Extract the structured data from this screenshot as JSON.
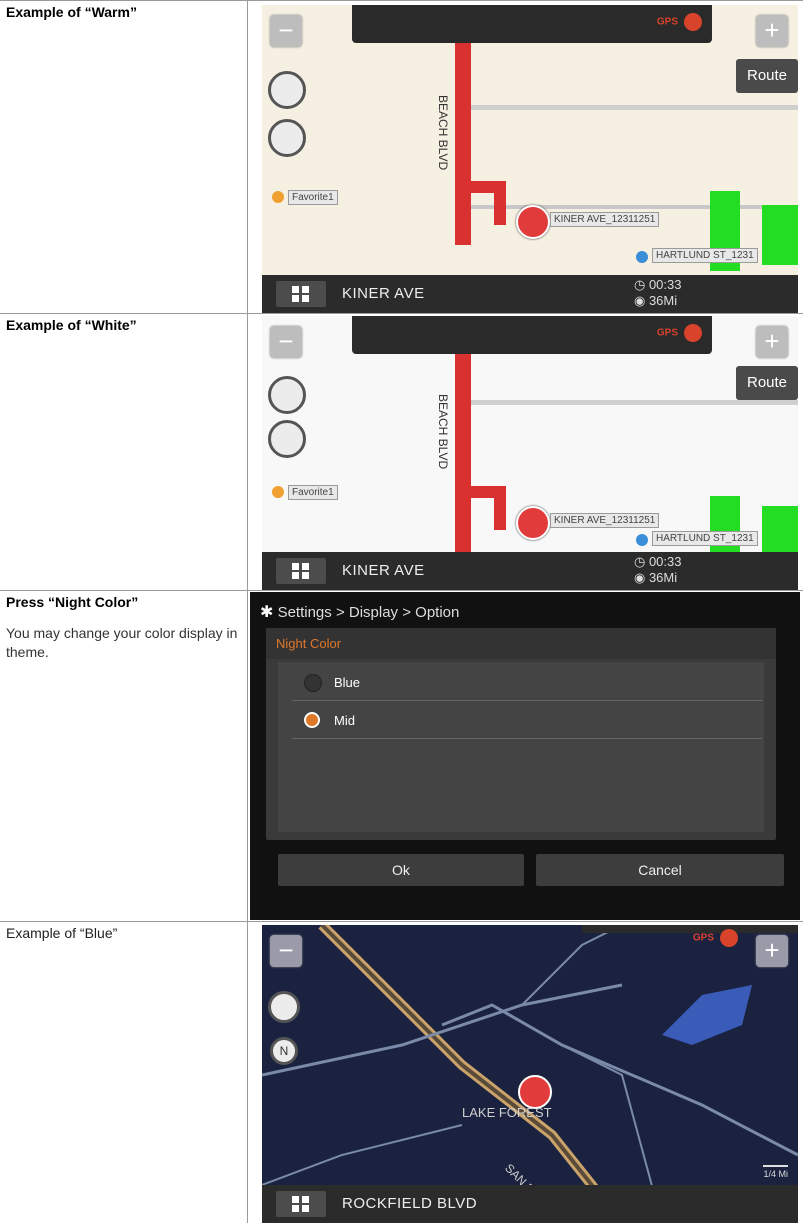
{
  "rows": [
    {
      "label": "Example of “Warm”",
      "map": {
        "route_label": "Route",
        "gps_label": "GPS",
        "road_name": "BEACH BLVD",
        "favorite": "Favorite1",
        "tag_primary": "KINER AVE_12311251",
        "tag_secondary": "HARTLUND ST_1231",
        "street": "KINER AVE",
        "eta_time": "◷ 00:33",
        "eta_distance": "◉ 36Mi"
      }
    },
    {
      "label": "Example of “White”",
      "map": {
        "route_label": "Route",
        "gps_label": "GPS",
        "road_name": "BEACH BLVD",
        "favorite": "Favorite1",
        "tag_primary": "KINER AVE_12311251",
        "tag_secondary": "HARTLUND ST_1231",
        "street": "KINER AVE",
        "eta_time": "◷ 00:33",
        "eta_distance": "◉ 36Mi"
      }
    },
    {
      "label": "Press “Night Color”",
      "description": "You may change your color display in theme.",
      "settings": {
        "breadcrumb": "Settings > Display > Option",
        "section": "Night Color",
        "options": [
          "Blue",
          "Mid"
        ],
        "selected": "Mid",
        "ok": "Ok",
        "cancel": "Cancel"
      }
    },
    {
      "label": "Example of “Blue”",
      "map": {
        "gps_label": "GPS",
        "place": "LAKE FOREST",
        "road": "SAN DIEGO",
        "scale": "1/4 Mi",
        "street": "ROCKFIELD BLVD"
      }
    }
  ],
  "colors": {
    "warm_bg": "#f6f0e2",
    "white_bg": "#f8f8f8",
    "route_red": "#d93030",
    "night_bg": "#1a2240",
    "accent_orange": "#e0782a"
  }
}
